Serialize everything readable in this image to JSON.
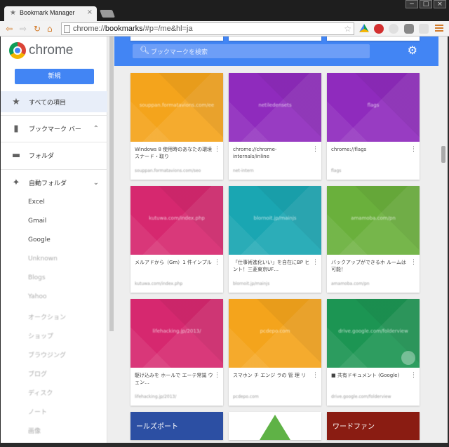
{
  "window": {
    "tab_title": "Bookmark Manager",
    "tab_close": "×",
    "controls": [
      "−",
      "□",
      "×"
    ]
  },
  "toolbar": {
    "url_prefix": "chrome://",
    "url_host": "bookmarks",
    "url_suffix": "/#p=/me&hl=ja"
  },
  "sidebar": {
    "logo_text": "chrome",
    "new_button": "新規",
    "items": [
      {
        "label": "すべての項目",
        "icon": "star-icon"
      },
      {
        "label": "ブックマーク バー",
        "icon": "bookmark-icon"
      },
      {
        "label": "フォルダ",
        "icon": "folder-icon"
      },
      {
        "label": "自動フォルダ",
        "icon": "auto-folder-icon"
      }
    ],
    "subitems": [
      "Excel",
      "Gmail",
      "Google",
      "Unknown",
      "Blogs",
      "Yahoo",
      "オークション",
      "ショップ",
      "ブラウジング",
      "ブログ",
      "ディスク",
      "ノート",
      "画像"
    ]
  },
  "header": {
    "search_placeholder": "ブックマークを検索"
  },
  "colors": {
    "accent": "#4285f4",
    "orange": "#f4a41c",
    "purple": "#8f2bbd",
    "pink": "#d6286f",
    "teal": "#1aa6b2",
    "green": "#6ab03c",
    "dark_green": "#1c9553"
  },
  "cards": [
    {
      "color": "#f4a41c",
      "url": "souppan.formatavions.com/ee",
      "title": "Windows 8 使用時のあなたの環境スナード・取り",
      "sub": "souppan.formatavions.com/seo"
    },
    {
      "color": "#8f2bbd",
      "url": "netiledensets",
      "title": "chrome://chrome-internals/inline",
      "sub": "net-intern"
    },
    {
      "color": "#8f2bbd",
      "url": "flags",
      "title": "chrome://flags",
      "sub": "flags"
    },
    {
      "color": "#d6286f",
      "url": "kutuwa.com/index.php",
      "title": "メルアドから（Gm）1 件インプル",
      "sub": "kutuwa.com/index.php"
    },
    {
      "color": "#1aa6b2",
      "url": "blornoit.jp/mainjs",
      "title": "「仕事術進化いい」を自在にBP ヒント！三菱東京UF…",
      "sub": "blornoit.jp/mainjs"
    },
    {
      "color": "#6ab03c",
      "url": "amamoba.com/pn",
      "title": "バックアップができるホ ルームは可能！",
      "sub": "amamoba.com/pn"
    },
    {
      "color": "#d6286f",
      "url": "lifehacking.jp/2013/",
      "title": "駆け込みを ホールで エーテ常識 ウェン…",
      "sub": "lifehacking.jp/2013/"
    },
    {
      "color": "#f4a41c",
      "url": "pcdepo.com",
      "title": "スマホン チ エンジ ラの 管 理 リ",
      "sub": "pcdepo.com"
    },
    {
      "color": "#1c9553",
      "url": "drive.google.com/folderview",
      "title": "■ 共有ドキュメント (Google)",
      "sub": "drive.google.com/folderview"
    }
  ],
  "bottom_row": [
    {
      "color": "#2c4fa3",
      "label": "ールズポート"
    },
    {
      "color": "#ffffff",
      "label": ""
    },
    {
      "color": "#8a1c12",
      "label": "ワードファン"
    }
  ]
}
